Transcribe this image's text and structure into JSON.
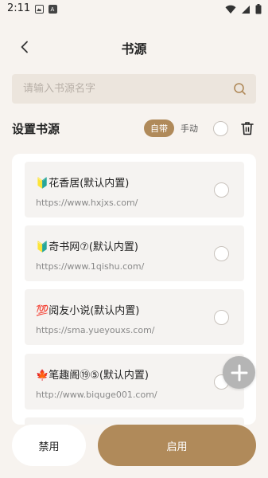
{
  "status_bar": {
    "time": "2:11",
    "left_icons": [
      "gallery-icon",
      "app-icon"
    ],
    "right_icons": [
      "wifi-icon",
      "signal-icon",
      "battery-icon"
    ]
  },
  "header": {
    "title": "书源",
    "back_icon": "chevron-left-icon"
  },
  "search": {
    "placeholder": "请输入书源名字",
    "value": "",
    "icon": "search-icon"
  },
  "toolbar": {
    "section_title": "设置书源",
    "mode_options": [
      {
        "label": "自带",
        "active": true
      },
      {
        "label": "手动",
        "active": false
      }
    ],
    "select_all_checked": false,
    "delete_icon": "trash-icon"
  },
  "sources": [
    {
      "badge": "🔰",
      "name": "花香居(默认内置)",
      "url": "https://www.hxjxs.com/",
      "checked": false
    },
    {
      "badge": "🔰",
      "name": "奇书网⑦(默认内置)",
      "url": "https://www.1qishu.com/",
      "checked": false
    },
    {
      "badge": "💯",
      "name": "阅友小说(默认内置)",
      "url": "https://sma.yueyouxs.com/",
      "checked": false
    },
    {
      "badge": "🍁",
      "name": "笔趣阁⑲⑤(默认内置)",
      "url": "http://www.biquge001.com/",
      "checked": false
    }
  ],
  "actions": {
    "add_icon": "plus-icon",
    "disable_label": "禁用",
    "enable_label": "启用"
  },
  "colors": {
    "accent": "#b08a5a",
    "background": "#f7f3ef",
    "fab": "#b5b5b5"
  }
}
